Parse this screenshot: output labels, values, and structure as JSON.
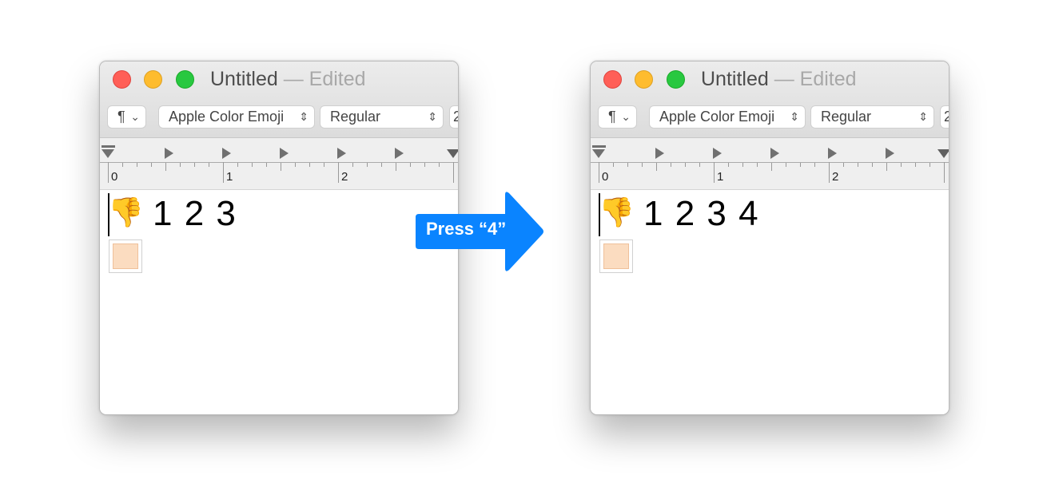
{
  "windows": [
    {
      "title": "Untitled",
      "edited": "— Edited",
      "paragraph_label": "¶",
      "font_family": "Apple Color Emoji",
      "font_style": "Regular",
      "font_size_partial": "2",
      "ruler_labels": [
        "0",
        "1",
        "2"
      ],
      "emoji": "👎",
      "text": "1 2 3"
    },
    {
      "title": "Untitled",
      "edited": "— Edited",
      "paragraph_label": "¶",
      "font_family": "Apple Color Emoji",
      "font_style": "Regular",
      "font_size_partial": "2",
      "ruler_labels": [
        "0",
        "1",
        "2"
      ],
      "emoji": "👎",
      "text": "1 2 3 4"
    }
  ],
  "arrow": {
    "label": "Press “4”",
    "color": "#0a84ff"
  },
  "colors": {
    "close": "#ff5f57",
    "minimize": "#febc2e",
    "zoom": "#28c840",
    "swatch": "#fbdcc0"
  }
}
